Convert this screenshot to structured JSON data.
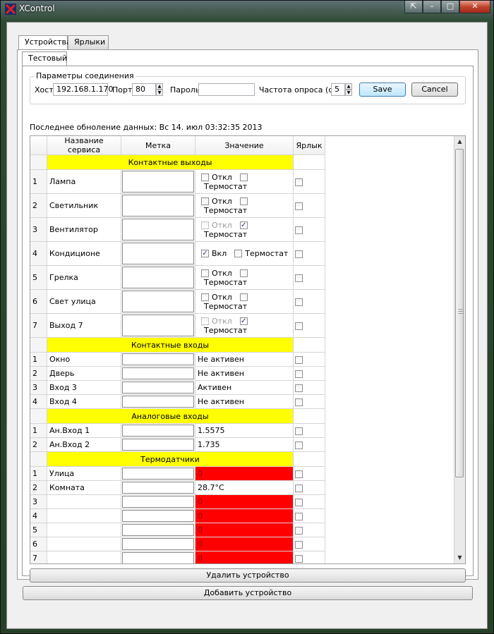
{
  "window": {
    "title": "XControl",
    "icon": "xcontrol-app-icon",
    "buttons": [
      "restore-icon",
      "minimize-icon",
      "maximize-icon",
      "close-icon"
    ]
  },
  "tabs": {
    "top": [
      "Устройства",
      "Ярлыки"
    ],
    "device": [
      "Тестовый"
    ]
  },
  "connection": {
    "title": "Параметры соединения",
    "host_label": "Хост",
    "host_value": "192.168.1.170",
    "port_label": "Порт",
    "port_value": "80",
    "password_label": "Пароль",
    "password_value": "",
    "interval_label": "Частота опроса (сек)",
    "interval_value": "5",
    "save_label": "Save",
    "cancel_label": "Cancel"
  },
  "last_update": "Последнее обноление данных: Вс 14. июл 03:32:35 2013",
  "table": {
    "headers": [
      "Название сервиса",
      "Метка",
      "Значение",
      "Ярлык"
    ],
    "sections": [
      {
        "title": "Контактные выходы"
      },
      {
        "title": "Контактные входы"
      },
      {
        "title": "Аналоговые входы"
      },
      {
        "title": "Термодатчики"
      }
    ],
    "outputs": [
      {
        "n": "1",
        "name": "Лампа",
        "state": "Откл",
        "state_checked": false,
        "state_disabled": false,
        "thermostat": "Термостат",
        "thermo_checked": false
      },
      {
        "n": "2",
        "name": "Светильник",
        "state": "Откл",
        "state_checked": false,
        "state_disabled": false,
        "thermostat": "Термостат",
        "thermo_checked": false
      },
      {
        "n": "3",
        "name": "Вентилятор",
        "state": "Откл",
        "state_checked": false,
        "state_disabled": true,
        "thermostat": "Термостат",
        "thermo_checked": true
      },
      {
        "n": "4",
        "name": "Кондиционе",
        "state": "Вкл",
        "state_checked": true,
        "state_disabled": false,
        "thermostat": "Термостат",
        "thermo_checked": false
      },
      {
        "n": "5",
        "name": "Грелка",
        "state": "Откл",
        "state_checked": false,
        "state_disabled": false,
        "thermostat": "Термостат",
        "thermo_checked": false
      },
      {
        "n": "6",
        "name": "Свет улица",
        "state": "Откл",
        "state_checked": false,
        "state_disabled": false,
        "thermostat": "Термостат",
        "thermo_checked": false
      },
      {
        "n": "7",
        "name": "Выход 7",
        "state": "Откл",
        "state_checked": false,
        "state_disabled": true,
        "thermostat": "Термостат",
        "thermo_checked": true
      }
    ],
    "inputs": [
      {
        "n": "1",
        "name": "Окно",
        "value": "Не активен"
      },
      {
        "n": "2",
        "name": "Дверь",
        "value": "Не активен"
      },
      {
        "n": "3",
        "name": "Вход 3",
        "value": "Активен"
      },
      {
        "n": "4",
        "name": "Вход 4",
        "value": "Не активен"
      }
    ],
    "analog": [
      {
        "n": "1",
        "name": "Ан.Вход 1",
        "value": "1.5575"
      },
      {
        "n": "2",
        "name": "Ан.Вход 2",
        "value": "1.735"
      }
    ],
    "thermo": [
      {
        "n": "1",
        "name": "Улица",
        "value": "0",
        "alarm": true
      },
      {
        "n": "2",
        "name": "Комната",
        "value": "28.7°C",
        "alarm": false
      },
      {
        "n": "3",
        "name": "",
        "value": "0",
        "alarm": true
      },
      {
        "n": "4",
        "name": "",
        "value": "0",
        "alarm": true
      },
      {
        "n": "5",
        "name": "",
        "value": "0",
        "alarm": true
      },
      {
        "n": "6",
        "name": "",
        "value": "0",
        "alarm": true
      },
      {
        "n": "7",
        "name": "",
        "value": "0",
        "alarm": true
      }
    ]
  },
  "buttons": {
    "delete_device": "Удалить устройство",
    "add_device": "Добавить устройство"
  },
  "colors": {
    "section_bg": "#ffff00",
    "alarm_bg": "#ff0000"
  }
}
